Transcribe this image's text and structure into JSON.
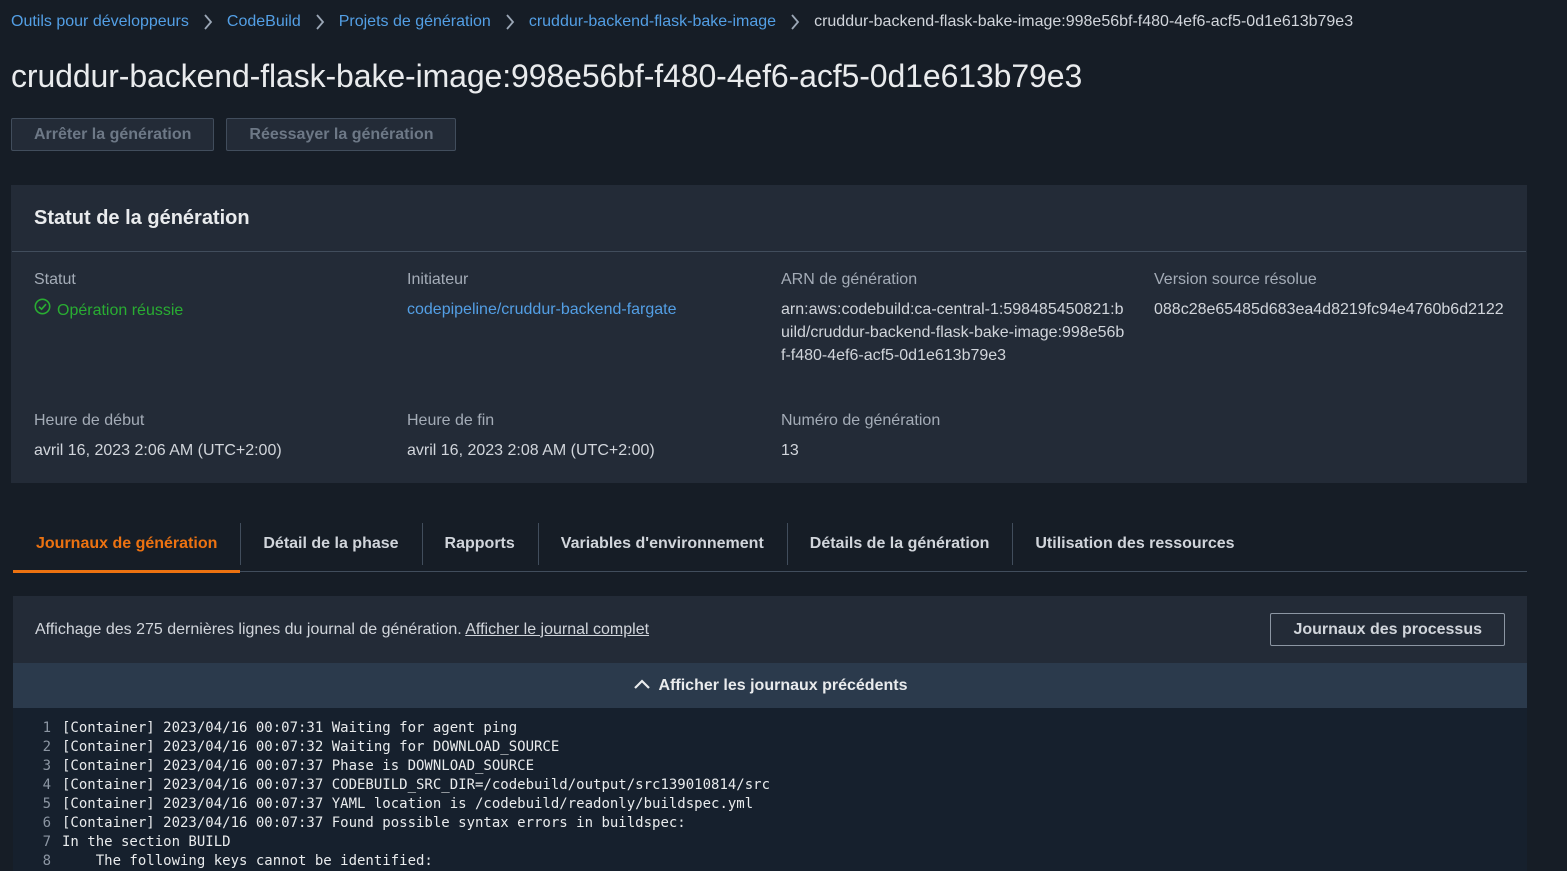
{
  "breadcrumb": [
    {
      "label": "Outils pour développeurs"
    },
    {
      "label": "CodeBuild"
    },
    {
      "label": "Projets de génération"
    },
    {
      "label": "cruddur-backend-flask-bake-image"
    }
  ],
  "breadcrumb_current": "cruddur-backend-flask-bake-image:998e56bf-f480-4ef6-acf5-0d1e613b79e3",
  "page_title": "cruddur-backend-flask-bake-image:998e56bf-f480-4ef6-acf5-0d1e613b79e3",
  "actions": {
    "stop_label": "Arrêter la génération",
    "retry_label": "Réessayer la génération"
  },
  "status_panel": {
    "title": "Statut de la génération",
    "status_label": "Statut",
    "status_value": "Opération réussie",
    "initiator_label": "Initiateur",
    "initiator_value": "codepipeline/cruddur-backend-fargate",
    "arn_label": "ARN de génération",
    "arn_value": "arn:aws:codebuild:ca-central-1:598485450821:build/cruddur-backend-flask-bake-image:998e56bf-f480-4ef6-acf5-0d1e613b79e3",
    "source_version_label": "Version source résolue",
    "source_version_value": "088c28e65485d683ea4d8219fc94e4760b6d2122",
    "start_label": "Heure de début",
    "start_value": "avril 16, 2023 2:06 AM (UTC+2:00)",
    "end_label": "Heure de fin",
    "end_value": "avril 16, 2023 2:08 AM (UTC+2:00)",
    "build_number_label": "Numéro de génération",
    "build_number_value": "13"
  },
  "tabs": [
    {
      "label": "Journaux de génération",
      "active": true
    },
    {
      "label": "Détail de la phase"
    },
    {
      "label": "Rapports"
    },
    {
      "label": "Variables d'environnement"
    },
    {
      "label": "Détails de la génération"
    },
    {
      "label": "Utilisation des ressources"
    }
  ],
  "logs": {
    "info_text": "Affichage des 275 dernières lignes du journal de génération.",
    "full_log_link": "Afficher le journal complet",
    "process_logs_button": "Journaux des processus",
    "show_previous": "Afficher les journaux précédents",
    "lines": [
      {
        "n": "1",
        "text": "[Container] 2023/04/16 00:07:31 Waiting for agent ping"
      },
      {
        "n": "2",
        "text": "[Container] 2023/04/16 00:07:32 Waiting for DOWNLOAD_SOURCE"
      },
      {
        "n": "3",
        "text": "[Container] 2023/04/16 00:07:37 Phase is DOWNLOAD_SOURCE"
      },
      {
        "n": "4",
        "text": "[Container] 2023/04/16 00:07:37 CODEBUILD_SRC_DIR=/codebuild/output/src139010814/src"
      },
      {
        "n": "5",
        "text": "[Container] 2023/04/16 00:07:37 YAML location is /codebuild/readonly/buildspec.yml"
      },
      {
        "n": "6",
        "text": "[Container] 2023/04/16 00:07:37 Found possible syntax errors in buildspec:"
      },
      {
        "n": "7",
        "text": "In the section BUILD"
      },
      {
        "n": "8",
        "text": "    The following keys cannot be identified:"
      }
    ]
  },
  "colors": {
    "link": "#539fe5",
    "success": "#29ad32",
    "active_tab": "#ec7211",
    "background": "#161d26",
    "panel": "#232b37"
  }
}
